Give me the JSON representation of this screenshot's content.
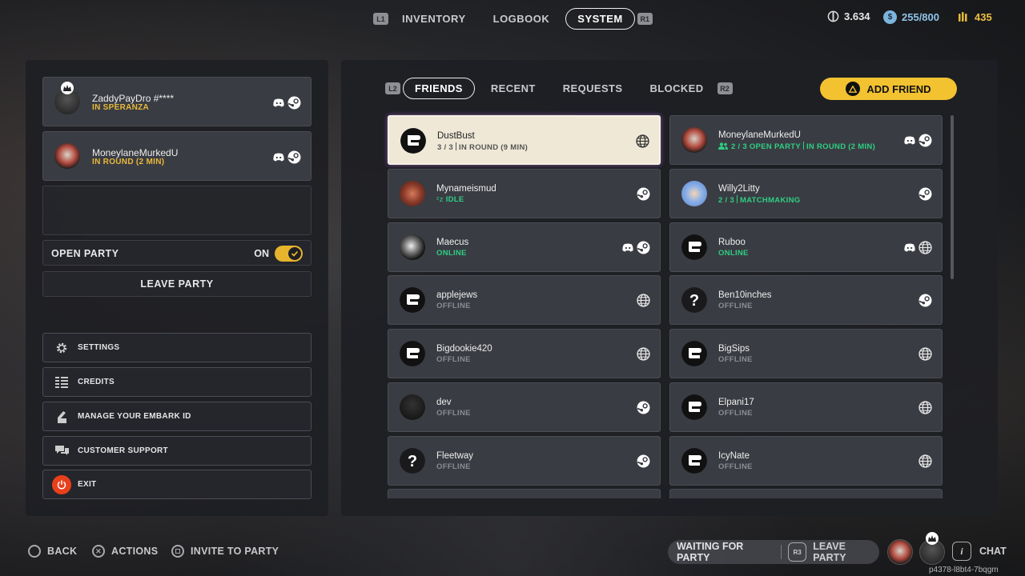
{
  "top_nav": {
    "left_key": "L1",
    "tabs": [
      "INVENTORY",
      "LOGBOOK",
      "SYSTEM"
    ],
    "active_tab": "SYSTEM",
    "right_key": "R1"
  },
  "currencies": [
    {
      "icon": "coin-icon",
      "value": "3.634"
    },
    {
      "icon": "credits-icon",
      "value": "255/800"
    },
    {
      "icon": "tickets-icon",
      "value": "435"
    }
  ],
  "party": {
    "members": [
      {
        "name": "ZaddyPayDro #****",
        "status": "IN SPERANZA",
        "leader": true,
        "platforms": [
          "discord-icon",
          "steam-icon"
        ]
      },
      {
        "name": "MoneylaneMurkedU",
        "status": "IN ROUND (2 MIN)",
        "leader": false,
        "platforms": [
          "discord-icon",
          "steam-icon"
        ]
      }
    ],
    "open_party_label": "OPEN PARTY",
    "open_party_state": "ON",
    "leave_party_label": "LEAVE PARTY"
  },
  "menu": [
    {
      "icon": "gear-icon",
      "label": "SETTINGS"
    },
    {
      "icon": "credits-list-icon",
      "label": "CREDITS"
    },
    {
      "icon": "id-icon",
      "label": "MANAGE YOUR EMBARK ID"
    },
    {
      "icon": "support-icon",
      "label": "CUSTOMER SUPPORT"
    },
    {
      "icon": "power-icon",
      "label": "EXIT"
    }
  ],
  "friends_tabs": {
    "left_key": "L2",
    "tabs": [
      "FRIENDS",
      "RECENT",
      "REQUESTS",
      "BLOCKED"
    ],
    "active_tab": "FRIENDS",
    "right_key": "R2",
    "add_friend_label": "ADD FRIEND"
  },
  "friends": [
    {
      "name": "DustBust",
      "status_a": "3 / 3",
      "status_b": "IN ROUND (9 MIN)",
      "platform": "globe-icon"
    },
    {
      "name": "MoneylaneMurkedU",
      "status_a": "2 / 3 OPEN PARTY",
      "status_b": "IN ROUND (2 MIN)",
      "platform": "steam-icon"
    },
    {
      "name": "Mynameismud",
      "status": "IDLE",
      "platform": "steam-icon"
    },
    {
      "name": "Willy2Litty",
      "status_a": "2 / 3",
      "status_b": "MATCHMAKING",
      "platform": "steam-icon"
    },
    {
      "name": "Maecus",
      "status": "ONLINE",
      "platform": "steam-icon"
    },
    {
      "name": "Ruboo",
      "status": "ONLINE",
      "platform": "globe-icon"
    },
    {
      "name": "applejews",
      "status": "OFFLINE",
      "platform": "globe-icon"
    },
    {
      "name": "Ben10inches",
      "status": "OFFLINE",
      "platform": "steam-icon"
    },
    {
      "name": "Bigdookie420",
      "status": "OFFLINE",
      "platform": "globe-icon"
    },
    {
      "name": "BigSips",
      "status": "OFFLINE",
      "platform": "globe-icon"
    },
    {
      "name": "dev",
      "status": "OFFLINE",
      "platform": "steam-icon"
    },
    {
      "name": "Elpani17",
      "status": "OFFLINE",
      "platform": "globe-icon"
    },
    {
      "name": "Fleetway",
      "status": "OFFLINE",
      "platform": "steam-icon"
    },
    {
      "name": "IcyNate",
      "status": "OFFLINE",
      "platform": "globe-icon"
    }
  ],
  "bottom": {
    "back": "BACK",
    "actions": "ACTIONS",
    "invite": "INVITE TO PARTY",
    "waiting": "WAITING FOR PARTY",
    "r3_key": "R3",
    "leave_party": "LEAVE PARTY",
    "chat_key": "i",
    "chat": "CHAT",
    "code": "p4378-l8bt4-7bqgm"
  },
  "colors": {
    "accent": "#f2c230",
    "online": "#2ecf83",
    "status_gold": "#e8b93a"
  }
}
